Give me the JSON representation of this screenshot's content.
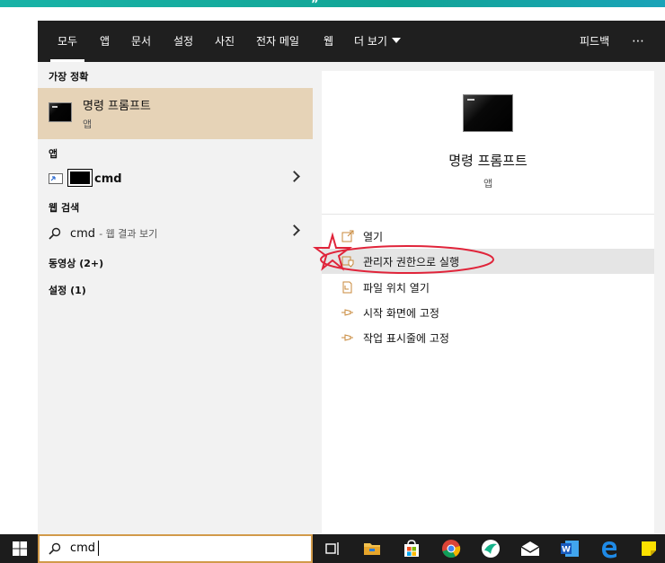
{
  "top": {
    "quote_mark": "”"
  },
  "topbar": {
    "tabs": [
      "모두",
      "앱",
      "문서",
      "설정",
      "사진",
      "전자 메일",
      "웹",
      "더 보기"
    ],
    "feedback": "피드백",
    "more_icon": "⋯"
  },
  "left": {
    "best_match_header": "가장 정확",
    "best_match": {
      "title": "명령 프롬프트",
      "subtitle": "앱"
    },
    "apps_header": "앱",
    "app_item": "cmd",
    "web_header": "웹 검색",
    "web_item": {
      "query": "cmd",
      "hint": "- 웹 결과 보기"
    },
    "videos_header": "동영상 (2+)",
    "settings_header": "설정 (1)"
  },
  "right": {
    "title": "명령 프롬프트",
    "subtitle": "앱",
    "actions": [
      "열기",
      "관리자 권한으로 실행",
      "파일 위치 열기",
      "시작 화면에 고정",
      "작업 표시줄에 고정"
    ]
  },
  "taskbar": {
    "search_value": "cmd"
  },
  "colors": {
    "accent_orange": "#c8893b",
    "highlight": "#e6d3b7",
    "annotation_red": "#e0243a"
  }
}
